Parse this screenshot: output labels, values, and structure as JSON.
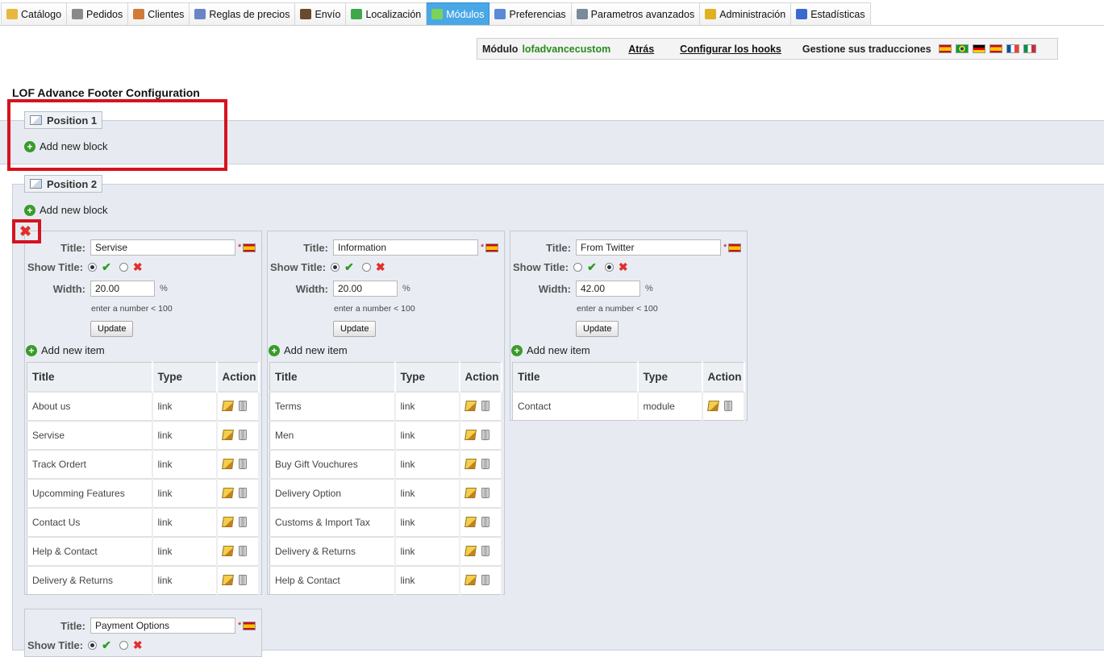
{
  "nav": {
    "tabs": [
      {
        "label": "Catálogo",
        "icon": "folder-icon",
        "color": "#e6b840"
      },
      {
        "label": "Pedidos",
        "icon": "cart-icon",
        "color": "#8a8a8a"
      },
      {
        "label": "Clientes",
        "icon": "user-icon",
        "color": "#d07a3a"
      },
      {
        "label": "Reglas de precios",
        "icon": "price-rules-icon",
        "color": "#6a84c8"
      },
      {
        "label": "Envío",
        "icon": "truck-icon",
        "color": "#6b4a2b"
      },
      {
        "label": "Localización",
        "icon": "globe-icon",
        "color": "#3fa84a"
      },
      {
        "label": "Módulos",
        "icon": "puzzle-icon",
        "color": "#7bd35a"
      },
      {
        "label": "Preferencias",
        "icon": "preferences-icon",
        "color": "#5a8ad4"
      },
      {
        "label": "Parametros avanzados",
        "icon": "wrench-icon",
        "color": "#7a8a9a"
      },
      {
        "label": "Administración",
        "icon": "key-icon",
        "color": "#e0b020"
      },
      {
        "label": "Estadísticas",
        "icon": "bar-chart-icon",
        "color": "#3a6ad0"
      }
    ],
    "active_index": 6
  },
  "module_bar": {
    "module_label": "Módulo",
    "module_name": "lofadvancecustom",
    "back": "Atrás",
    "hooks": "Configurar los hooks",
    "translations": "Gestione sus traducciones",
    "flags": [
      "es-flag-icon",
      "br-flag-icon",
      "de-flag-icon",
      "es-flag-icon",
      "fr-flag-icon",
      "it-flag-icon"
    ]
  },
  "page_title": "LOF Advance Footer Configuration",
  "labels": {
    "add_new_block": "Add new block",
    "add_new_item": "Add new item",
    "title": "Title:",
    "show_title": "Show Title:",
    "width": "Width:",
    "hint": "enter a number < 100",
    "update": "Update",
    "col_title": "Title",
    "col_type": "Type",
    "col_action": "Action",
    "required": "*",
    "percent": "%"
  },
  "position1": {
    "label": "Position 1"
  },
  "position2": {
    "label": "Position 2",
    "blocks": [
      {
        "title": "Servise",
        "show_title": true,
        "width": "20.00",
        "items": [
          {
            "title": "About us",
            "type": "link"
          },
          {
            "title": "Servise",
            "type": "link"
          },
          {
            "title": "Track Ordert",
            "type": "link"
          },
          {
            "title": "Upcomming Features",
            "type": "link"
          },
          {
            "title": "Contact Us",
            "type": "link"
          },
          {
            "title": "Help & Contact",
            "type": "link"
          },
          {
            "title": "Delivery & Returns",
            "type": "link"
          }
        ]
      },
      {
        "title": "Information",
        "show_title": true,
        "width": "20.00",
        "items": [
          {
            "title": "Terms",
            "type": "link"
          },
          {
            "title": "Men",
            "type": "link"
          },
          {
            "title": "Buy Gift Vouchures",
            "type": "link"
          },
          {
            "title": "Delivery Option",
            "type": "link"
          },
          {
            "title": "Customs & Import Tax",
            "type": "link"
          },
          {
            "title": "Delivery & Returns",
            "type": "link"
          },
          {
            "title": "Help & Contact",
            "type": "link"
          }
        ]
      },
      {
        "title": "From Twitter",
        "show_title": false,
        "width": "42.00",
        "items": [
          {
            "title": "Contact",
            "type": "module"
          }
        ]
      },
      {
        "title": "Payment Options",
        "show_title": true,
        "width": "",
        "items": []
      }
    ]
  },
  "colors": {
    "active_tab": "#49a7e6",
    "highlight": "#d6121f",
    "module_name": "#2a8a1f",
    "panel_bg": "#e7ebf1"
  }
}
